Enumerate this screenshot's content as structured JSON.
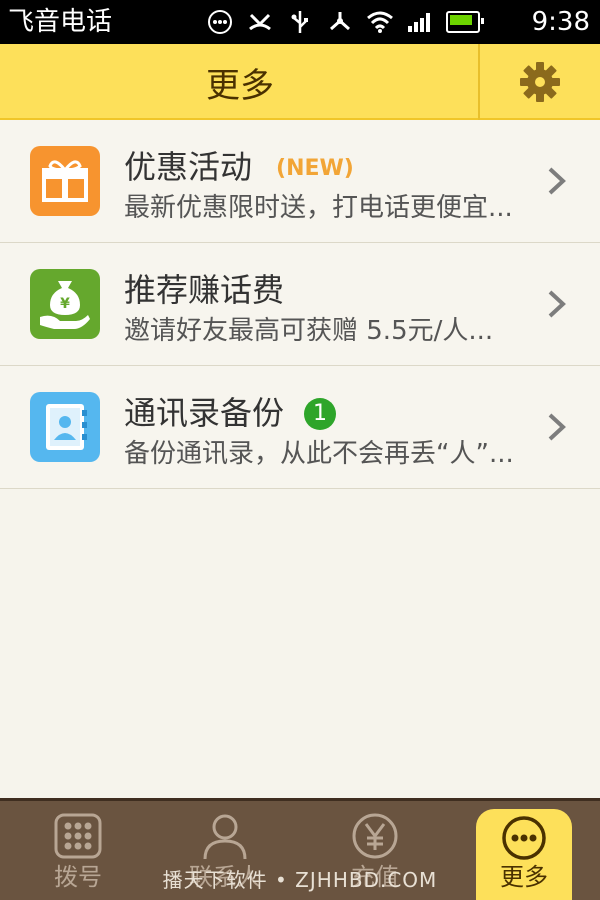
{
  "status_bar": {
    "app_name": "飞音电话",
    "time": "9:38"
  },
  "header": {
    "title": "更多",
    "settings_icon": "gear-icon"
  },
  "list": [
    {
      "title": "优惠活动",
      "badge": "(NEW)",
      "subtitle": "最新优惠限时送，打电话更便宜...",
      "icon": "gift-icon",
      "icon_color": "#f7942f"
    },
    {
      "title": "推荐赚话费",
      "subtitle": "邀请好友最高可获赠 5.5元/人...",
      "icon": "money-bag-icon",
      "icon_color": "#65a82d"
    },
    {
      "title": "通讯录备份",
      "badge_count": "1",
      "subtitle": "备份通讯录，从此不会再丢“人”...",
      "icon": "contacts-book-icon",
      "icon_color": "#55b7ef"
    }
  ],
  "tabs": [
    {
      "label": "拨号",
      "icon": "dialpad-icon"
    },
    {
      "label": "联系人",
      "icon": "person-icon"
    },
    {
      "label": "充值",
      "icon": "yen-coin-icon"
    },
    {
      "label": "更多",
      "icon": "more-dots-icon",
      "active": true
    }
  ],
  "watermark": "播天下软件 • ZJHHBD.COM",
  "colors": {
    "accent": "#fde05a",
    "tabbar": "#6a5440",
    "background": "#f6f4ec"
  }
}
